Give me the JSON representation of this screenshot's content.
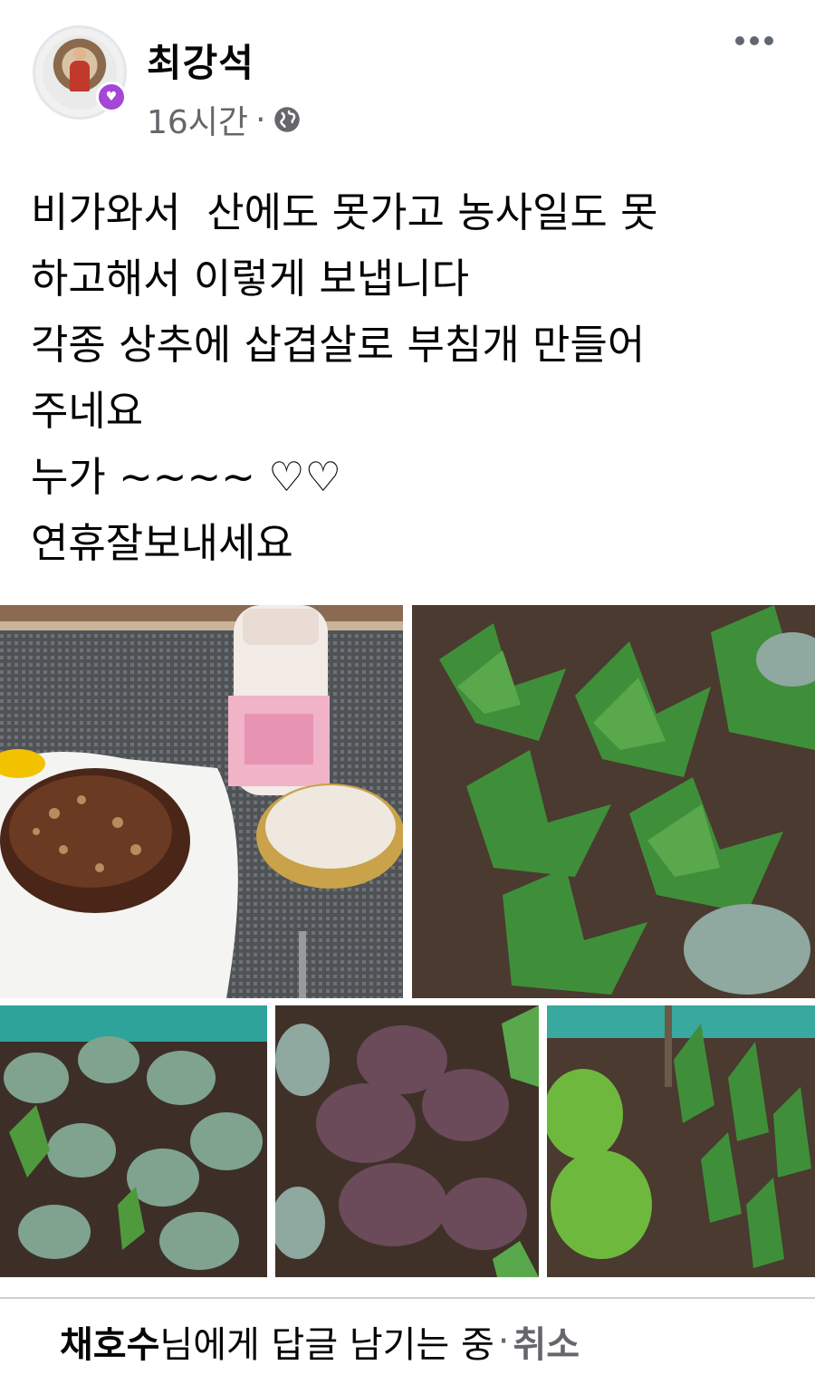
{
  "post": {
    "author": "최강석",
    "time": "16시간",
    "separator": "·",
    "privacy_icon": "globe-icon",
    "text": "비가와서  산에도 못가고 농사일도 못\n하고해서 이렇게 보냅니다\n각종 상추에 삽겹살로 부침개 만들어\n주네요\n누가 ~~~~ ♡♡\n연휴잘보내세요"
  },
  "reply_bar": {
    "name": "채호수",
    "text": "님에게 답글 남기는 중",
    "separator": "·",
    "cancel": "취소"
  },
  "colors": {
    "text": "#050505",
    "secondary": "#65676b",
    "badge": "#a446d6"
  }
}
